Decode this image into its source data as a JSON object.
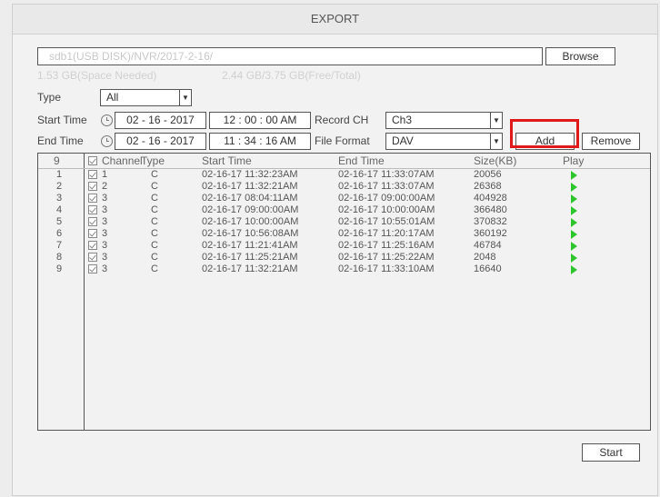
{
  "window": {
    "title": "EXPORT"
  },
  "path": {
    "value": "sdb1(USB DISK)/NVR/2017-2-16/"
  },
  "browse_label": "Browse",
  "space": {
    "needed": "1.53 GB(Space Needed)",
    "free_total": "2.44 GB/3.75 GB(Free/Total)"
  },
  "filters": {
    "type_label": "Type",
    "type_value": "All",
    "start_label": "Start Time",
    "start_date": "02 - 16 - 2017",
    "start_time": "12 : 00 : 00 AM",
    "end_label": "End Time",
    "end_date": "02 - 16 - 2017",
    "end_time": "11 : 34 : 16 AM",
    "record_ch_label": "Record CH",
    "record_ch_value": "Ch3",
    "file_format_label": "File Format",
    "file_format_value": "DAV"
  },
  "buttons": {
    "add": "Add",
    "remove": "Remove",
    "start": "Start"
  },
  "table": {
    "count": "9",
    "headers": {
      "channel": "Channel",
      "type": "Type",
      "start": "Start Time",
      "end": "End Time",
      "size": "Size(KB)",
      "play": "Play"
    },
    "rows": [
      {
        "idx": "1",
        "ch": "1",
        "type": "C",
        "start": "02-16-17 11:32:23AM",
        "end": "02-16-17 11:33:07AM",
        "size": "20056"
      },
      {
        "idx": "2",
        "ch": "2",
        "type": "C",
        "start": "02-16-17 11:32:21AM",
        "end": "02-16-17 11:33:07AM",
        "size": "26368"
      },
      {
        "idx": "3",
        "ch": "3",
        "type": "C",
        "start": "02-16-17 08:04:11AM",
        "end": "02-16-17 09:00:00AM",
        "size": "404928"
      },
      {
        "idx": "4",
        "ch": "3",
        "type": "C",
        "start": "02-16-17 09:00:00AM",
        "end": "02-16-17 10:00:00AM",
        "size": "366480"
      },
      {
        "idx": "5",
        "ch": "3",
        "type": "C",
        "start": "02-16-17 10:00:00AM",
        "end": "02-16-17 10:55:01AM",
        "size": "370832"
      },
      {
        "idx": "6",
        "ch": "3",
        "type": "C",
        "start": "02-16-17 10:56:08AM",
        "end": "02-16-17 11:20:17AM",
        "size": "360192"
      },
      {
        "idx": "7",
        "ch": "3",
        "type": "C",
        "start": "02-16-17 11:21:41AM",
        "end": "02-16-17 11:25:16AM",
        "size": "46784"
      },
      {
        "idx": "8",
        "ch": "3",
        "type": "C",
        "start": "02-16-17 11:25:21AM",
        "end": "02-16-17 11:25:22AM",
        "size": "2048"
      },
      {
        "idx": "9",
        "ch": "3",
        "type": "C",
        "start": "02-16-17 11:32:21AM",
        "end": "02-16-17 11:33:10AM",
        "size": "16640"
      }
    ]
  },
  "colors": {
    "play": "#2cc52c",
    "highlight": "#e01a1a"
  }
}
